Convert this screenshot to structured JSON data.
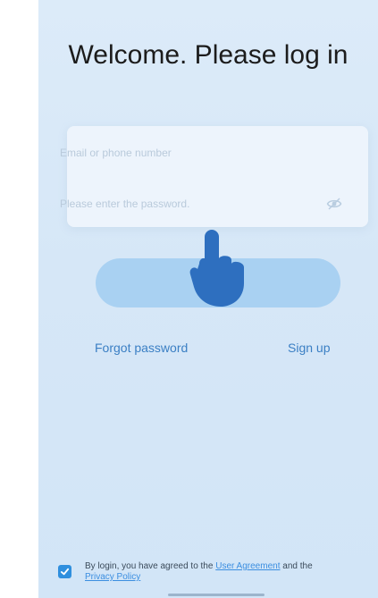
{
  "title": "Welcome. Please log in",
  "form": {
    "email_placeholder": "Email or phone number",
    "password_placeholder": "Please enter the password.",
    "eye_icon": "eye-toggle-icon"
  },
  "links": {
    "forgot": "Forgot password",
    "signup": "Sign up"
  },
  "agreement": {
    "checked": true,
    "prefix": "By login, you have agreed to the ",
    "user_agreement": "User Agreement",
    "middle": " and the ",
    "privacy_policy": "Privacy Policy"
  },
  "colors": {
    "accent": "#3b7fc4",
    "button": "#a9d1f2",
    "checkbox": "#2f8fde",
    "hand": "#2e6fbf"
  }
}
